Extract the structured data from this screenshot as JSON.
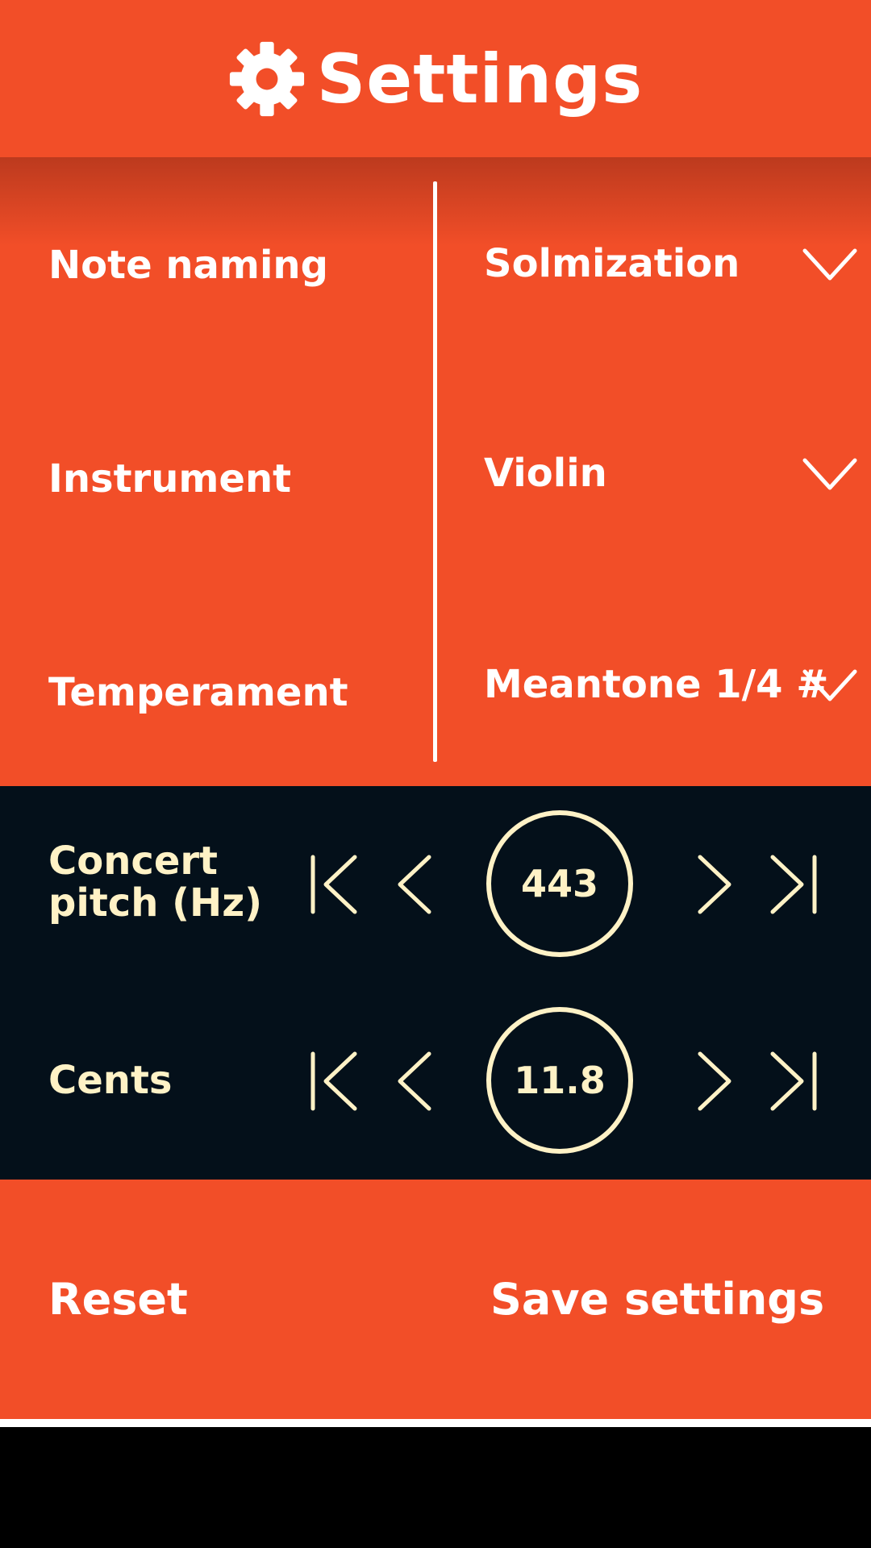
{
  "header": {
    "title": "Settings",
    "icon": "gear-icon"
  },
  "settings": {
    "note_naming": {
      "label": "Note naming",
      "value": "Solmization"
    },
    "instrument": {
      "label": "Instrument",
      "value": "Violin"
    },
    "temperament": {
      "label": "Temperament",
      "value": "Meantone 1/4 #"
    }
  },
  "controls": {
    "concert_pitch": {
      "label_line1": "Concert",
      "label_line2": "pitch (Hz)",
      "value": "443"
    },
    "cents": {
      "label": "Cents",
      "value": "11.8"
    }
  },
  "actions": {
    "reset": "Reset",
    "save": "Save settings"
  },
  "colors": {
    "accent": "#F24E28",
    "dark_panel": "#04101A",
    "cream": "#FFF2C6",
    "white": "#FFFFFF"
  }
}
